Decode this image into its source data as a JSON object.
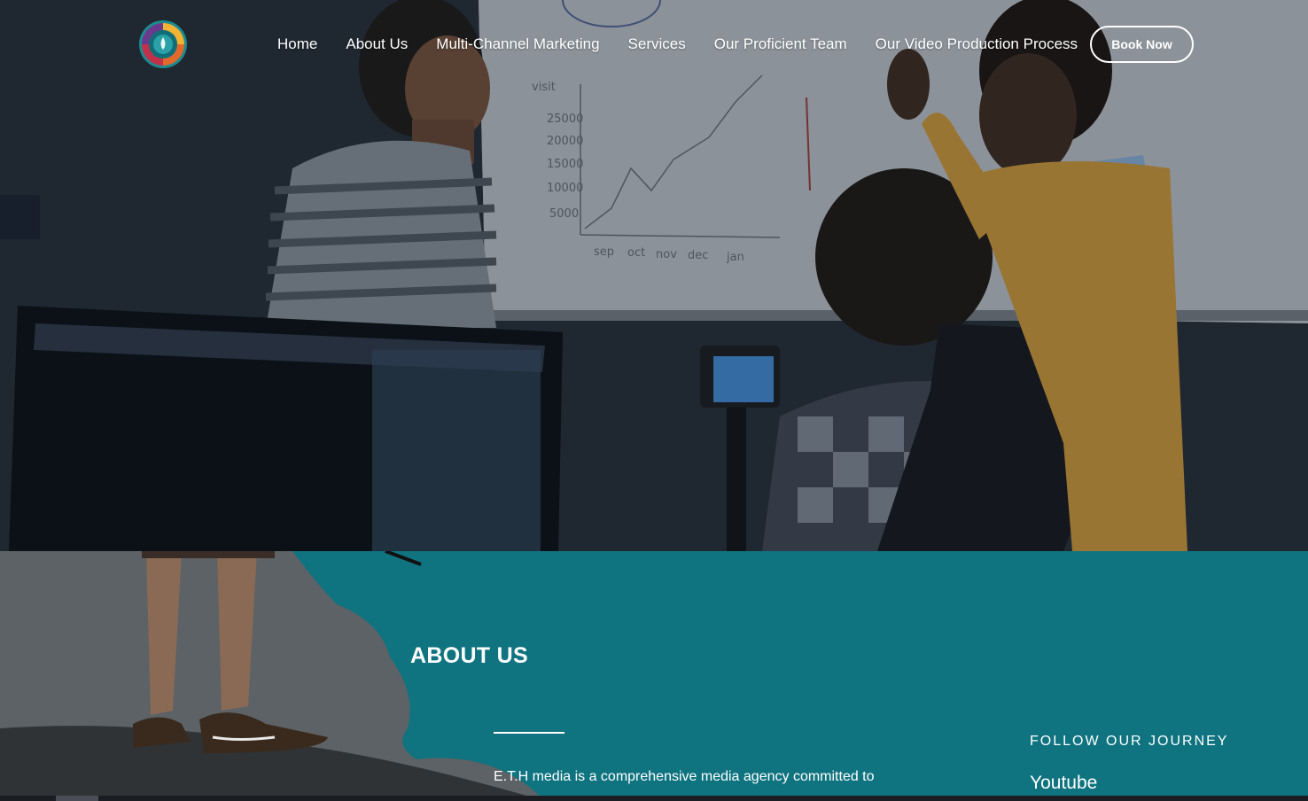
{
  "nav": {
    "logo_icon": "swirl-logo-icon",
    "items": [
      {
        "label": "Home"
      },
      {
        "label": "About Us"
      },
      {
        "label": "Multi-Channel Marketing"
      },
      {
        "label": "Services"
      },
      {
        "label": "Our Proficient Team"
      },
      {
        "label": "Our Video Production Process"
      }
    ],
    "book_label": "Book Now"
  },
  "hero": {
    "whiteboard": {
      "y_axis_label": "visit",
      "y_ticks": [
        "25000",
        "20000",
        "15000",
        "10000",
        "5000"
      ],
      "x_ticks": [
        "sep",
        "oct",
        "nov",
        "dec",
        "jan"
      ]
    }
  },
  "about": {
    "title": "ABOUT US",
    "text": "E.T.H media is a comprehensive media agency committed to",
    "follow_heading": "FOLLOW OUR JOURNEY",
    "social_links": [
      "Youtube"
    ]
  },
  "colors": {
    "accent_teal": "#0f7480",
    "white": "#ffffff"
  }
}
